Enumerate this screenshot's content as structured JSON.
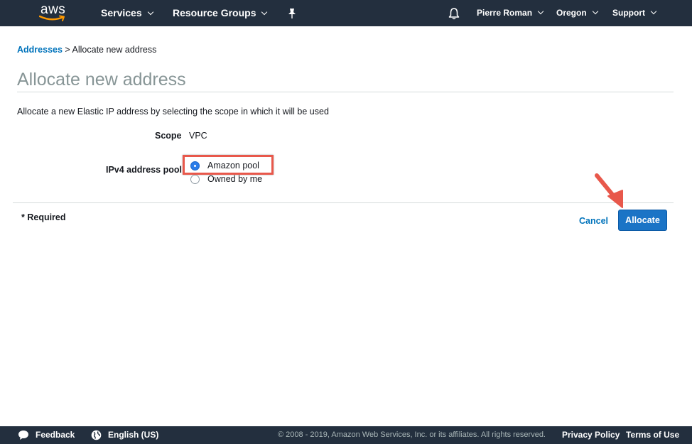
{
  "topnav": {
    "logo_text": "aws",
    "services_label": "Services",
    "resource_groups_label": "Resource Groups",
    "user_label": "Pierre Roman",
    "region_label": "Oregon",
    "support_label": "Support"
  },
  "breadcrumb": {
    "parent_label": "Addresses",
    "separator": ">",
    "current_label": "Allocate new address"
  },
  "page": {
    "title": "Allocate new address",
    "description": "Allocate a new Elastic IP address by selecting the scope in which it will be used"
  },
  "form": {
    "scope_label": "Scope",
    "scope_value": "VPC",
    "pool_label": "IPv4 address pool",
    "pool_options": [
      {
        "label": "Amazon pool",
        "selected": true
      },
      {
        "label": "Owned by me",
        "selected": false
      }
    ],
    "required_note": "* Required",
    "cancel_label": "Cancel",
    "allocate_label": "Allocate"
  },
  "footer": {
    "feedback_label": "Feedback",
    "language_label": "English (US)",
    "copyright": "© 2008 - 2019, Amazon Web Services, Inc. or its affiliates. All rights reserved.",
    "privacy_label": "Privacy Policy",
    "terms_label": "Terms of Use"
  },
  "colors": {
    "nav_bg": "#232f3e",
    "link": "#0073bb",
    "primary_button": "#1b74c6",
    "highlight": "#e8584b",
    "logo_smile": "#ff9900"
  },
  "icons": [
    "aws-logo",
    "chevron-down-icon",
    "pin-icon",
    "bell-icon",
    "arrow-annotation-icon",
    "speech-bubble-icon",
    "globe-icon"
  ]
}
